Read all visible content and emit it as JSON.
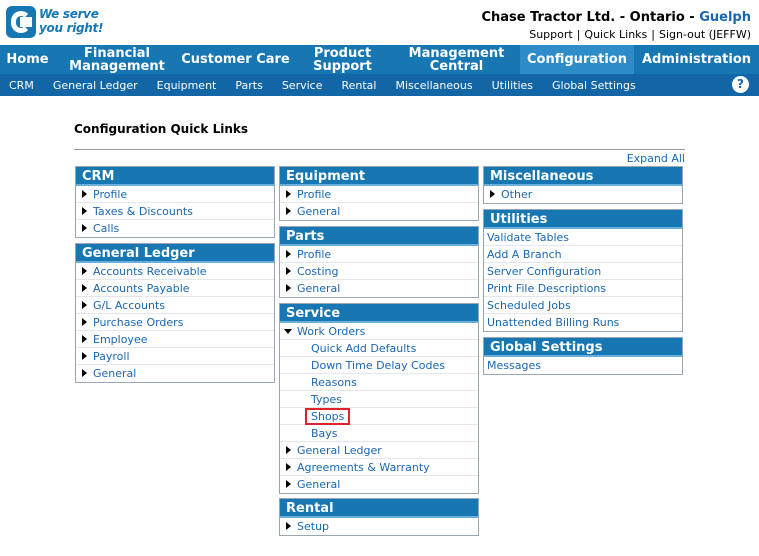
{
  "brand": {
    "tagline_line1": "We serve",
    "tagline_line2": "you right!",
    "logo_color": "#1777b3"
  },
  "header": {
    "company": "Chase Tractor Ltd. - Ontario - ",
    "branch": "Guelph",
    "links": [
      "Support",
      "Quick Links",
      "Sign-out (JEFFW)"
    ]
  },
  "main_nav": [
    {
      "label": "Home"
    },
    {
      "label": "Financial Management"
    },
    {
      "label": "Customer Care"
    },
    {
      "label": "Product Support"
    },
    {
      "label": "Management Central"
    },
    {
      "label": "Configuration",
      "active": true
    },
    {
      "label": "Administration"
    }
  ],
  "sub_nav": [
    "CRM",
    "General Ledger",
    "Equipment",
    "Parts",
    "Service",
    "Rental",
    "Miscellaneous",
    "Utilities",
    "Global Settings"
  ],
  "help_label": "?",
  "page_title": "Configuration Quick Links",
  "expand_all": "Expand All",
  "panels": {
    "crm": {
      "title": "CRM",
      "items": [
        "Profile",
        "Taxes & Discounts",
        "Calls"
      ]
    },
    "gl": {
      "title": "General Ledger",
      "items": [
        "Accounts Receivable",
        "Accounts Payable",
        "G/L Accounts",
        "Purchase Orders",
        "Employee",
        "Payroll",
        "General"
      ]
    },
    "equipment": {
      "title": "Equipment",
      "items": [
        "Profile",
        "General"
      ]
    },
    "parts": {
      "title": "Parts",
      "items": [
        "Profile",
        "Costing",
        "General"
      ]
    },
    "service": {
      "title": "Service",
      "work_orders": "Work Orders",
      "sub_items": [
        "Quick Add Defaults",
        "Down Time Delay Codes",
        "Reasons",
        "Types",
        "Shops",
        "Bays"
      ],
      "items": [
        "General Ledger",
        "Agreements & Warranty",
        "General"
      ]
    },
    "rental": {
      "title": "Rental",
      "items": [
        "Setup"
      ]
    },
    "misc": {
      "title": "Miscellaneous",
      "items": [
        "Other"
      ]
    },
    "utilities": {
      "title": "Utilities",
      "items": [
        "Validate Tables",
        "Add A Branch",
        "Server Configuration",
        "Print File Descriptions",
        "Scheduled Jobs",
        "Unattended Billing Runs"
      ]
    },
    "global": {
      "title": "Global Settings",
      "items": [
        "Messages"
      ]
    }
  },
  "colors": {
    "nav": "#1777b3",
    "subnav": "#1266a6",
    "link": "#1a67b0",
    "highlight": "#e2222a"
  }
}
